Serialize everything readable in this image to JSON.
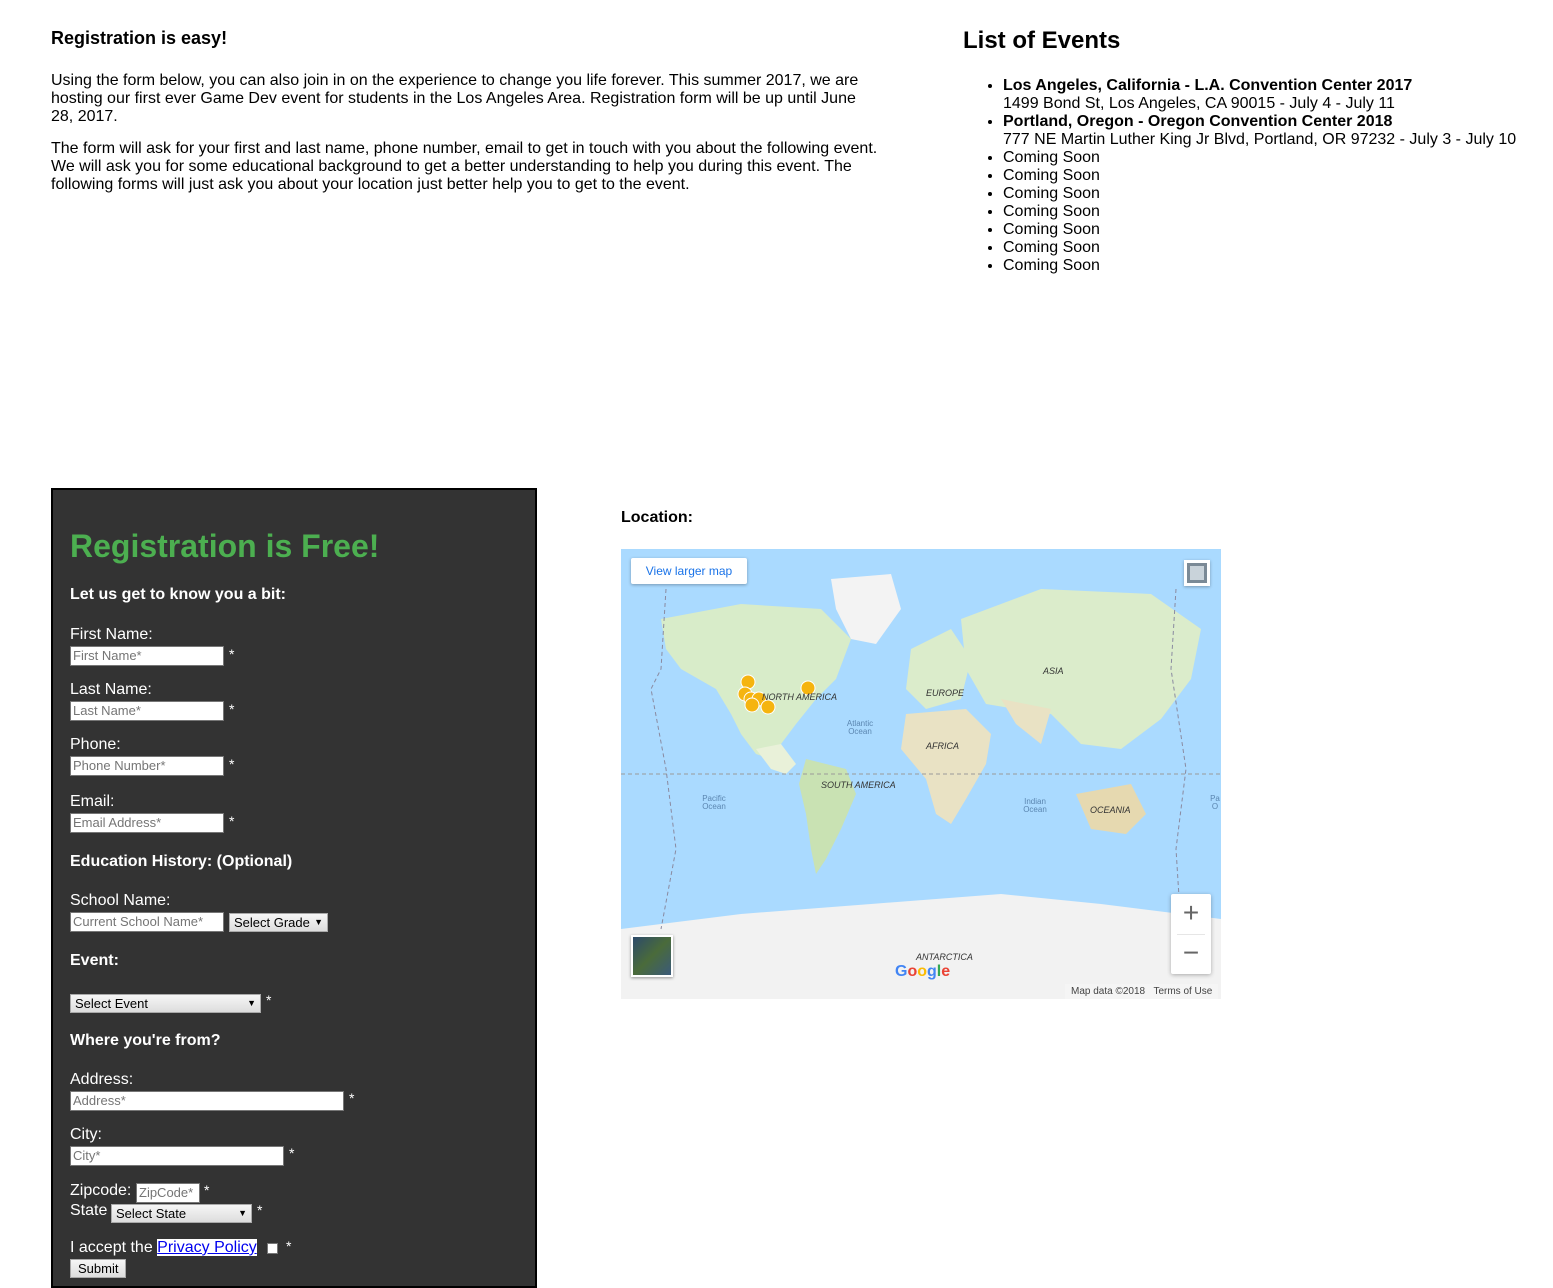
{
  "intro": {
    "heading": "Registration is easy!",
    "p1": "Using the form below, you can also join in on the experience to change you life forever. This summer 2017, we are hosting our first ever Game Dev event for students in the Los Angeles Area. Registration form will be up until June 28, 2017.",
    "p2": "The form will ask for your first and last name, phone number, email to get in touch with you about the following event. We will ask you for some educational background to get a better understanding to help you during this event. The following forms will just ask you about your location just better help you to get to the event."
  },
  "events": {
    "title": "List of Events",
    "featured": [
      {
        "name": "Los Angeles, California - L.A. Convention Center 2017",
        "detail": "1499 Bond St, Los Angeles, CA 90015 - July 4 - July 11"
      },
      {
        "name": "Portland, Oregon - Oregon Convention Center 2018",
        "detail": "777 NE Martin Luther King Jr Blvd, Portland, OR 97232 - July 3 - July 10"
      }
    ],
    "coming_soon": [
      "Coming Soon",
      "Coming Soon",
      "Coming Soon",
      "Coming Soon",
      "Coming Soon",
      "Coming Soon",
      "Coming Soon"
    ]
  },
  "form": {
    "title": "Registration is Free!",
    "section_about": "Let us get to know you a bit:",
    "first_name_label": "First Name:",
    "first_name_placeholder": "First Name*",
    "last_name_label": "Last Name:",
    "last_name_placeholder": "Last Name*",
    "phone_label": "Phone:",
    "phone_placeholder": "Phone Number*",
    "email_label": "Email:",
    "email_placeholder": "Email Address*",
    "section_education": "Education History: (Optional)",
    "school_label": "School Name:",
    "school_placeholder": "Current School Name*",
    "grade_select": "Select Grade",
    "section_event": "Event:",
    "event_select": "Select Event",
    "section_from": "Where you're from?",
    "address_label": "Address:",
    "address_placeholder": "Address*",
    "city_label": "City:",
    "city_placeholder": "City*",
    "zip_label": "Zipcode:",
    "zip_placeholder": "ZipCode*",
    "state_label": "State",
    "state_select": "Select State",
    "privacy_prefix": "I accept the",
    "privacy_link": "Privacy Policy",
    "required_mark": "*",
    "submit": "Submit"
  },
  "location": {
    "title": "Location:",
    "view_larger": "View larger map",
    "zoom_in": "+",
    "zoom_out": "−",
    "google": [
      "G",
      "o",
      "o",
      "g",
      "l",
      "e"
    ],
    "map_data": "Map data ©2018",
    "terms": "Terms of Use",
    "labels": {
      "north_america": "NORTH AMERICA",
      "south_america": "SOUTH AMERICA",
      "europe": "EUROPE",
      "asia": "ASIA",
      "africa": "AFRICA",
      "oceania": "OCEANIA",
      "antarctica": "ANTARCTICA",
      "atlantic": "Atlantic Ocean",
      "pacific": "Pacific Ocean",
      "indian": "Indian Ocean",
      "pacific_edge": "Pa O"
    }
  }
}
